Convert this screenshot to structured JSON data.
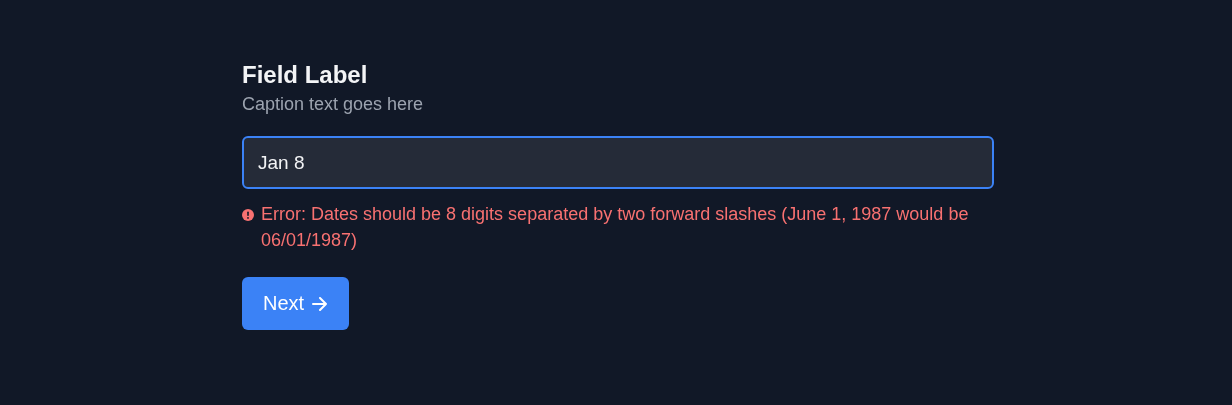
{
  "field": {
    "label": "Field Label",
    "caption": "Caption text goes here",
    "value": "Jan 8",
    "focused": true,
    "error": "Error: Dates should be 8 digits separated by two forward slashes (June 1, 1987 would be 06/01/1987)"
  },
  "button": {
    "label": "Next"
  }
}
